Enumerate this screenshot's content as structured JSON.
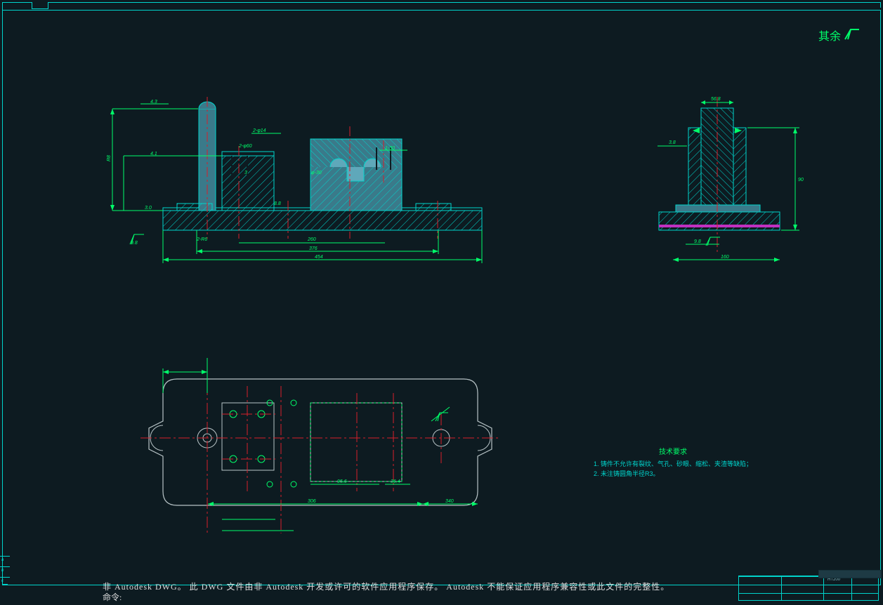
{
  "colors": {
    "accent": "#00d4cc",
    "hatch": "#00d4cc",
    "dim": "#00ff6a",
    "center": "#d81f2a",
    "outline": "#b8c4c7",
    "fill1": "#3a7a8a",
    "fill2": "#5fa8ba",
    "magenta": "#c030c0"
  },
  "surface_marker": {
    "label": "其余"
  },
  "tech_requirements": {
    "title": "技术要求",
    "items": [
      "1. 铸件不允许有裂纹、气孔、砂眼、缩松、夹渣等缺陷；",
      "2. 未注铸圆角半径R3。"
    ]
  },
  "warning_line": "非 Autodesk DWG。 此 DWG 文件由非 Autodesk 开发或许可的软件应用程序保存。 Autodesk 不能保证应用程序兼容性或此文件的完整性。",
  "command_prompt": "命令:",
  "command_value": "",
  "title_block": {
    "field1": "HT200"
  },
  "side_ticks": [
    "a",
    "b",
    "c"
  ],
  "front_view": {
    "dims_left": [
      "4.3",
      "4.1",
      "R8",
      "3.0"
    ],
    "dims_top": [
      "2-φ14"
    ],
    "dims_mid": [
      "2-φ60",
      "1-30",
      "φ-30",
      "3",
      "8.8"
    ],
    "dims_bot": [
      "2-R6",
      "260",
      "376",
      "454",
      "9.8"
    ]
  },
  "side_view": {
    "dims": [
      "56.8",
      "3.8",
      "90",
      "9.8",
      "160"
    ]
  },
  "top_view": {
    "dims": [
      "95.6",
      "306",
      "340",
      "36.4"
    ]
  }
}
